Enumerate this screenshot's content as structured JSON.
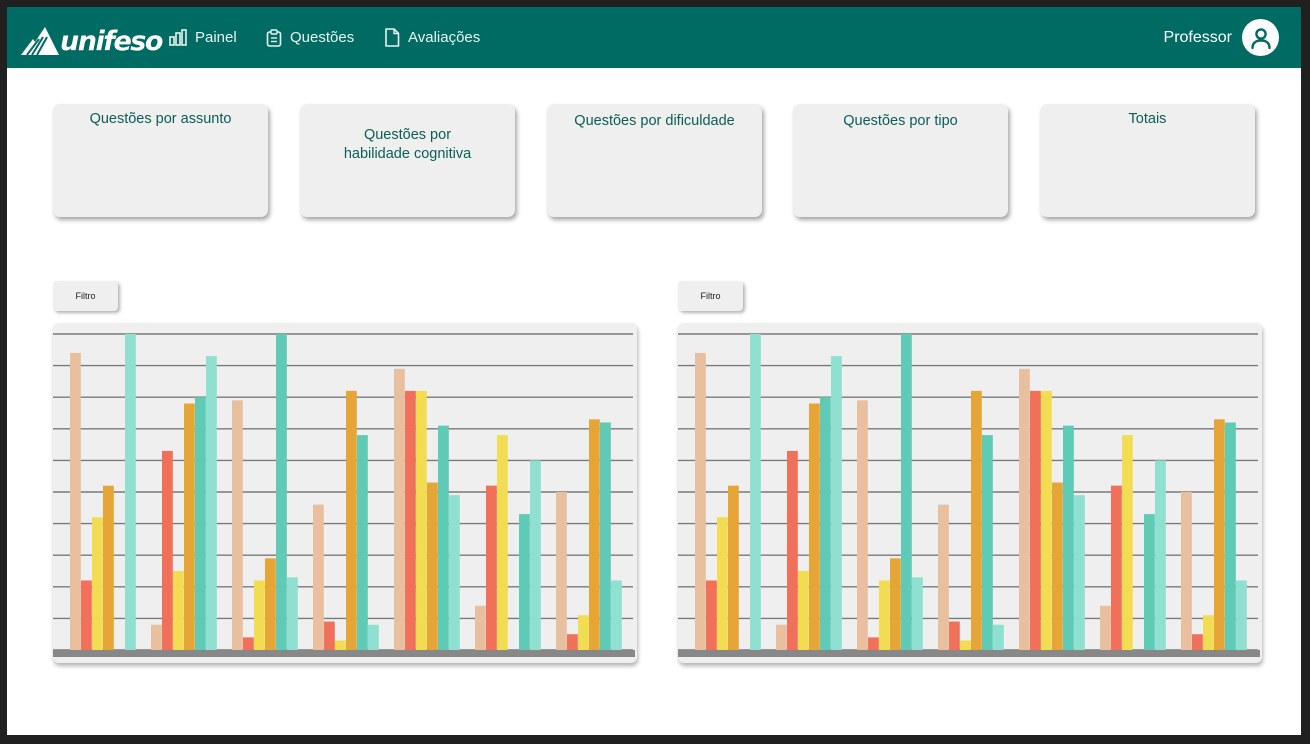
{
  "brand": {
    "name": "unifeso"
  },
  "nav": {
    "items": [
      {
        "label": "Painel",
        "icon": "bar-chart-icon"
      },
      {
        "label": "Questões",
        "icon": "clipboard-icon"
      },
      {
        "label": "Avaliações",
        "icon": "document-icon"
      }
    ]
  },
  "user": {
    "name": "Professor",
    "icon": "user-avatar-icon"
  },
  "cards": [
    {
      "title": "Questões por assunto"
    },
    {
      "title": "Questões por\nhabilidade cognitiva"
    },
    {
      "title": "Questões por dificuldade"
    },
    {
      "title": "Questões por tipo"
    },
    {
      "title": "Totais"
    }
  ],
  "charts": [
    {
      "filter_label": "Filtro"
    },
    {
      "filter_label": "Filtro"
    }
  ],
  "colors": {
    "header": "#006b63",
    "series": [
      "#e8bf9f",
      "#f0705a",
      "#f2dc52",
      "#e6a637",
      "#5fcab5",
      "#8fe0d0"
    ]
  },
  "chart_data": [
    {
      "type": "bar",
      "ylim": [
        0,
        10
      ],
      "grid": true,
      "series_colors": [
        "#e8bf9f",
        "#f0705a",
        "#f2dc52",
        "#e6a637",
        "#5fcab5",
        "#8fe0d0"
      ],
      "groups": [
        [
          9.4,
          2.2,
          4.2,
          5.2,
          0,
          10
        ],
        [
          0.8,
          6.3,
          2.5,
          7.8,
          8.0,
          9.3
        ],
        [
          7.9,
          0.4,
          2.2,
          2.9,
          10,
          2.3
        ],
        [
          4.6,
          0.9,
          0.3,
          8.2,
          6.8,
          0.8
        ],
        [
          8.9,
          8.2,
          8.2,
          5.3,
          7.1,
          4.9
        ],
        [
          1.4,
          5.2,
          6.8,
          0,
          4.3,
          6.0
        ],
        [
          5.0,
          0.5,
          1.1,
          7.3,
          7.2,
          2.2
        ]
      ]
    },
    {
      "type": "bar",
      "ylim": [
        0,
        10
      ],
      "grid": true,
      "series_colors": [
        "#e8bf9f",
        "#f0705a",
        "#f2dc52",
        "#e6a637",
        "#5fcab5",
        "#8fe0d0"
      ],
      "groups": [
        [
          9.4,
          2.2,
          4.2,
          5.2,
          0,
          10
        ],
        [
          0.8,
          6.3,
          2.5,
          7.8,
          8.0,
          9.3
        ],
        [
          7.9,
          0.4,
          2.2,
          2.9,
          10,
          2.3
        ],
        [
          4.6,
          0.9,
          0.3,
          8.2,
          6.8,
          0.8
        ],
        [
          8.9,
          8.2,
          8.2,
          5.3,
          7.1,
          4.9
        ],
        [
          1.4,
          5.2,
          6.8,
          0,
          4.3,
          6.0
        ],
        [
          5.0,
          0.5,
          1.1,
          7.3,
          7.2,
          2.2
        ]
      ]
    }
  ]
}
